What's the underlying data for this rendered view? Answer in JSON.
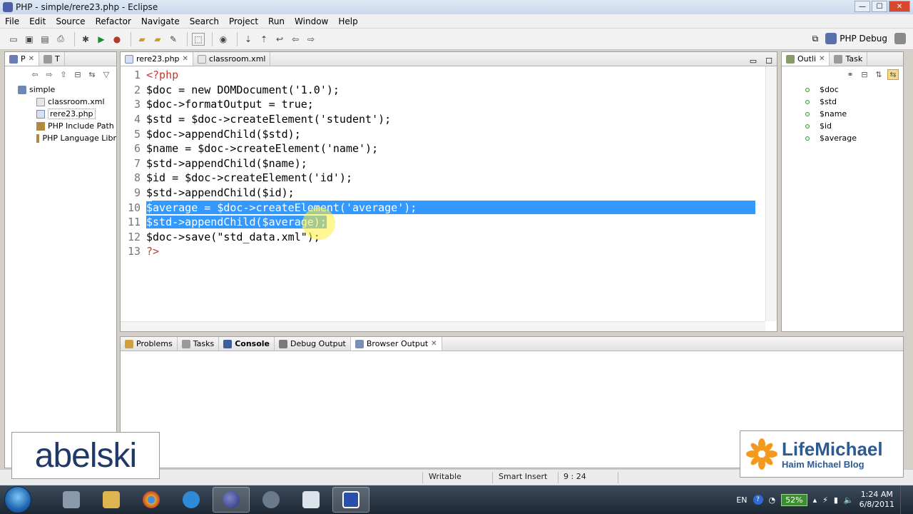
{
  "window": {
    "title": "PHP - simple/rere23.php - Eclipse"
  },
  "menubar": [
    "File",
    "Edit",
    "Source",
    "Refactor",
    "Navigate",
    "Search",
    "Project",
    "Run",
    "Window",
    "Help"
  ],
  "perspective": {
    "label": "PHP Debug"
  },
  "explorer": {
    "tabs": [
      {
        "label": "P"
      },
      {
        "label": "T"
      }
    ],
    "items": [
      {
        "label": "simple",
        "indent": 0,
        "icon": "folder-icon"
      },
      {
        "label": "classroom.xml",
        "indent": 1,
        "icon": "xml-file-icon"
      },
      {
        "label": "rere23.php",
        "indent": 1,
        "icon": "php-file-icon"
      },
      {
        "label": "PHP Include Path",
        "indent": 1,
        "icon": "library-icon"
      },
      {
        "label": "PHP Language Libr",
        "indent": 1,
        "icon": "library-icon"
      }
    ]
  },
  "editor": {
    "tabs": [
      {
        "label": "rere23.php",
        "active": true
      },
      {
        "label": "classroom.xml",
        "active": false
      }
    ],
    "lines": [
      {
        "n": "1",
        "text": "<?php"
      },
      {
        "n": "2",
        "text": "$doc = new DOMDocument('1.0');"
      },
      {
        "n": "3",
        "text": "$doc->formatOutput = true;"
      },
      {
        "n": "4",
        "text": "$std = $doc->createElement('student');"
      },
      {
        "n": "5",
        "text": "$doc->appendChild($std);"
      },
      {
        "n": "6",
        "text": "$name = $doc->createElement('name');"
      },
      {
        "n": "7",
        "text": "$std->appendChild($name);"
      },
      {
        "n": "8",
        "text": "$id = $doc->createElement('id');"
      },
      {
        "n": "9",
        "text": "$std->appendChild($id);"
      },
      {
        "n": "10",
        "text": "$average = $doc->createElement('average');"
      },
      {
        "n": "11",
        "text": "$std->appendChild($average);"
      },
      {
        "n": "12",
        "text": "$doc->save(\"std_data.xml\");"
      },
      {
        "n": "13",
        "text": "?>"
      }
    ]
  },
  "outline": {
    "tabs": [
      {
        "label": "Outli"
      },
      {
        "label": "Task"
      }
    ],
    "items": [
      "$doc",
      "$std",
      "$name",
      "$id",
      "$average"
    ]
  },
  "console": {
    "tabs": [
      {
        "label": "Problems"
      },
      {
        "label": "Tasks"
      },
      {
        "label": "Console"
      },
      {
        "label": "Debug Output"
      },
      {
        "label": "Browser Output"
      }
    ]
  },
  "status": {
    "mode": "Writable",
    "insert": "Smart Insert",
    "position": "9 : 24"
  },
  "watermarks": {
    "left": "abelski",
    "right_title": "LifeMichael",
    "right_subtitle": "Haim Michael Blog"
  },
  "tray": {
    "lang": "EN",
    "battery": "52%",
    "time": "1:24 AM",
    "date": "6/8/2011"
  },
  "colors": {
    "selection": "#3399ff",
    "keyword": "#7f0055",
    "string": "#2a00ff",
    "taskbar": "#1d2733"
  }
}
